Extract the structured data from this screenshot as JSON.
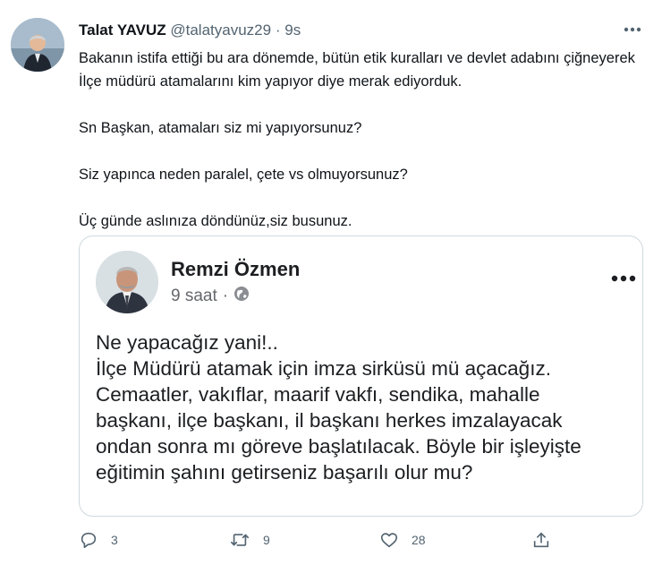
{
  "tweet": {
    "author_name": "Talat YAVUZ",
    "author_handle": "@talatyavuz29",
    "separator": "·",
    "time": "9s",
    "paragraphs": [
      "Bakanın istifa ettiği bu ara dönemde, bütün etik kuralları ve devlet adabını çiğneyerek İlçe müdürü atamalarını kim yapıyor diye merak ediyorduk.",
      "Sn Başkan, atamaları siz mi yapıyorsunuz?",
      "Siz yapınca neden paralel, çete vs olmuyorsunuz?",
      "Üç günde aslınıza döndünüz,siz busunuz."
    ]
  },
  "embedded_post": {
    "author_name": "Remzi Özmen",
    "time": "9 saat",
    "separator": "·",
    "lines": [
      "Ne yapacağız yani!..",
      "İlçe Müdürü atamak için imza sirküsü mü açacağız.",
      "Cemaatler, vakıflar, maarif vakfı, sendika, mahalle",
      "başkanı, ilçe başkanı, il başkanı herkes imzalayacak",
      "ondan sonra mı göreve başlatılacak. Böyle bir işleyişte",
      "eğitimin şahını getirseniz başarılı olur mu?"
    ]
  },
  "actions": {
    "reply_count": "3",
    "retweet_count": "9",
    "like_count": "28"
  },
  "icons": [
    "more-icon",
    "globe-icon",
    "reply-icon",
    "retweet-icon",
    "like-icon",
    "share-icon"
  ],
  "colors": {
    "text": "#0f1419",
    "secondary": "#536471",
    "border": "#cfd9de"
  }
}
